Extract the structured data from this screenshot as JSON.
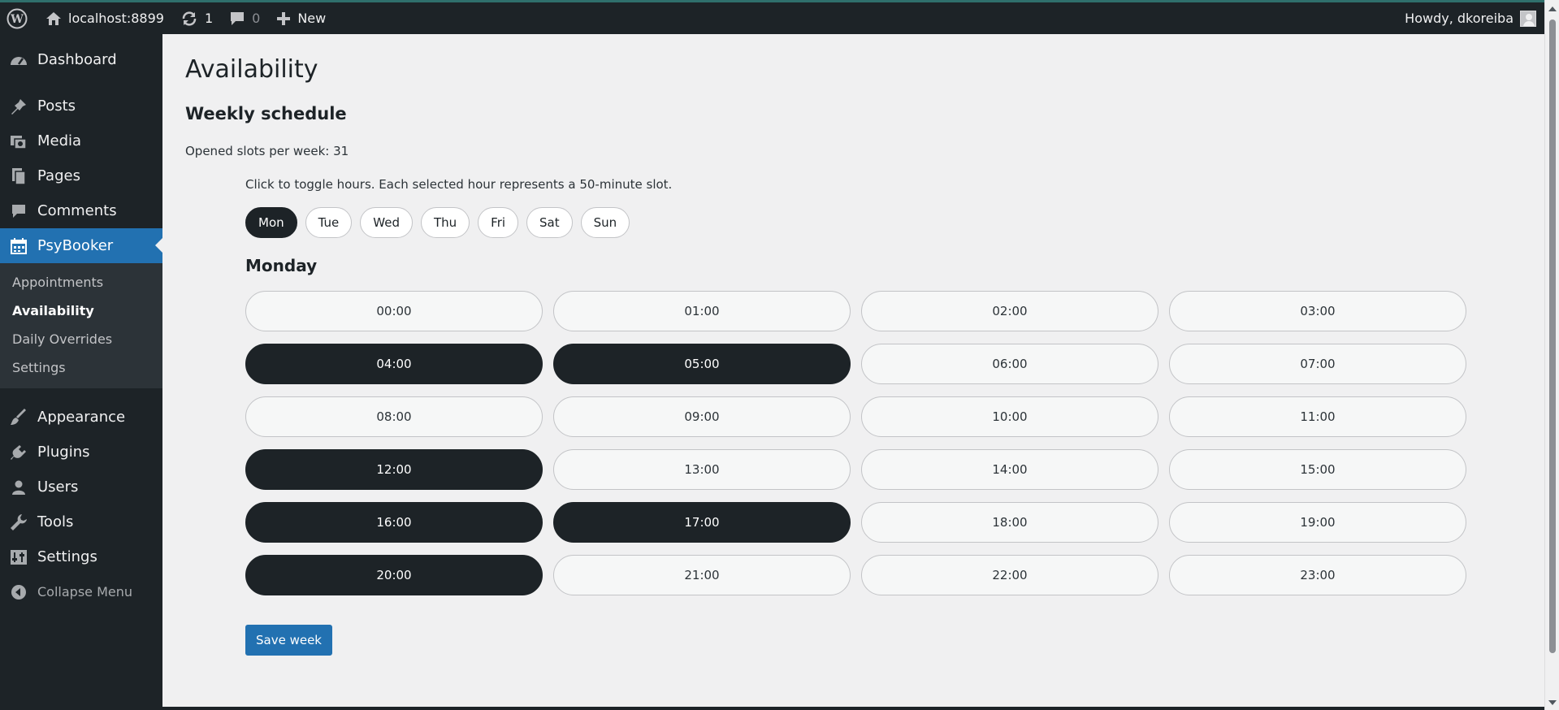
{
  "adminbar": {
    "site": "localhost:8899",
    "updates": "1",
    "comments": "0",
    "new_label": "New",
    "howdy": "Howdy, dkoreiba"
  },
  "sidebar": {
    "items_top": [
      {
        "label": "Dashboard",
        "icon": "dashboard-icon"
      },
      {
        "label": "Posts",
        "icon": "pin-icon"
      },
      {
        "label": "Media",
        "icon": "media-icon"
      },
      {
        "label": "Pages",
        "icon": "pages-icon"
      },
      {
        "label": "Comments",
        "icon": "comment-icon"
      },
      {
        "label": "PsyBooker",
        "icon": "calendar-icon"
      }
    ],
    "submenu": [
      "Appointments",
      "Availability",
      "Daily Overrides",
      "Settings"
    ],
    "items_bottom": [
      {
        "label": "Appearance",
        "icon": "brush-icon"
      },
      {
        "label": "Plugins",
        "icon": "plugin-icon"
      },
      {
        "label": "Users",
        "icon": "user-icon"
      },
      {
        "label": "Tools",
        "icon": "wrench-icon"
      },
      {
        "label": "Settings",
        "icon": "settings-icon"
      }
    ],
    "collapse": "Collapse Menu"
  },
  "main": {
    "title": "Availability",
    "section": "Weekly schedule",
    "slots_count": "Opened slots per week: 31",
    "hint": "Click to toggle hours. Each selected hour represents a 50-minute slot.",
    "days": [
      "Mon",
      "Tue",
      "Wed",
      "Thu",
      "Fri",
      "Sat",
      "Sun"
    ],
    "selected_day": "Mon",
    "day_title": "Monday",
    "slots": [
      {
        "time": "00:00",
        "on": false
      },
      {
        "time": "01:00",
        "on": false
      },
      {
        "time": "02:00",
        "on": false
      },
      {
        "time": "03:00",
        "on": false
      },
      {
        "time": "04:00",
        "on": true
      },
      {
        "time": "05:00",
        "on": true
      },
      {
        "time": "06:00",
        "on": false
      },
      {
        "time": "07:00",
        "on": false
      },
      {
        "time": "08:00",
        "on": false
      },
      {
        "time": "09:00",
        "on": false
      },
      {
        "time": "10:00",
        "on": false
      },
      {
        "time": "11:00",
        "on": false
      },
      {
        "time": "12:00",
        "on": true
      },
      {
        "time": "13:00",
        "on": false
      },
      {
        "time": "14:00",
        "on": false
      },
      {
        "time": "15:00",
        "on": false
      },
      {
        "time": "16:00",
        "on": true
      },
      {
        "time": "17:00",
        "on": true
      },
      {
        "time": "18:00",
        "on": false
      },
      {
        "time": "19:00",
        "on": false
      },
      {
        "time": "20:00",
        "on": true
      },
      {
        "time": "21:00",
        "on": false
      },
      {
        "time": "22:00",
        "on": false
      },
      {
        "time": "23:00",
        "on": false
      }
    ],
    "save_label": "Save week"
  },
  "colors": {
    "admin_dark": "#1d2327",
    "accent_blue": "#2271b1",
    "submenu_bg": "#2c3338",
    "page_bg": "#f0f0f1"
  }
}
